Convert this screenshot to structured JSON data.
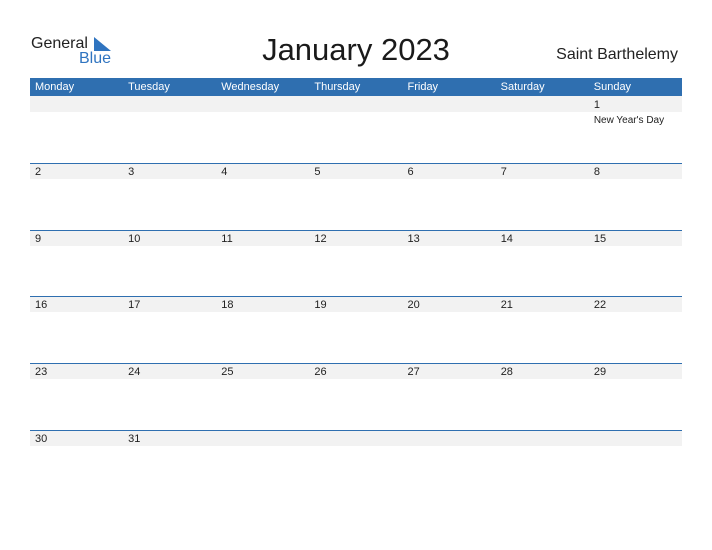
{
  "logo": {
    "word1": "General",
    "word2": "Blue",
    "icon": "triangle-flag-icon",
    "accent": "#2f74c0"
  },
  "title": "January 2023",
  "country": "Saint Barthelemy",
  "colors": {
    "header": "#2f6fb0",
    "band": "#f2f2f2"
  },
  "weekdays": [
    "Monday",
    "Tuesday",
    "Wednesday",
    "Thursday",
    "Friday",
    "Saturday",
    "Sunday"
  ],
  "weeks": [
    [
      {
        "d": ""
      },
      {
        "d": ""
      },
      {
        "d": ""
      },
      {
        "d": ""
      },
      {
        "d": ""
      },
      {
        "d": ""
      },
      {
        "d": "1",
        "holiday": "New Year's Day"
      }
    ],
    [
      {
        "d": "2"
      },
      {
        "d": "3"
      },
      {
        "d": "4"
      },
      {
        "d": "5"
      },
      {
        "d": "6"
      },
      {
        "d": "7"
      },
      {
        "d": "8"
      }
    ],
    [
      {
        "d": "9"
      },
      {
        "d": "10"
      },
      {
        "d": "11"
      },
      {
        "d": "12"
      },
      {
        "d": "13"
      },
      {
        "d": "14"
      },
      {
        "d": "15"
      }
    ],
    [
      {
        "d": "16"
      },
      {
        "d": "17"
      },
      {
        "d": "18"
      },
      {
        "d": "19"
      },
      {
        "d": "20"
      },
      {
        "d": "21"
      },
      {
        "d": "22"
      }
    ],
    [
      {
        "d": "23"
      },
      {
        "d": "24"
      },
      {
        "d": "25"
      },
      {
        "d": "26"
      },
      {
        "d": "27"
      },
      {
        "d": "28"
      },
      {
        "d": "29"
      }
    ],
    [
      {
        "d": "30"
      },
      {
        "d": "31"
      },
      {
        "d": ""
      },
      {
        "d": ""
      },
      {
        "d": ""
      },
      {
        "d": ""
      },
      {
        "d": ""
      }
    ]
  ]
}
